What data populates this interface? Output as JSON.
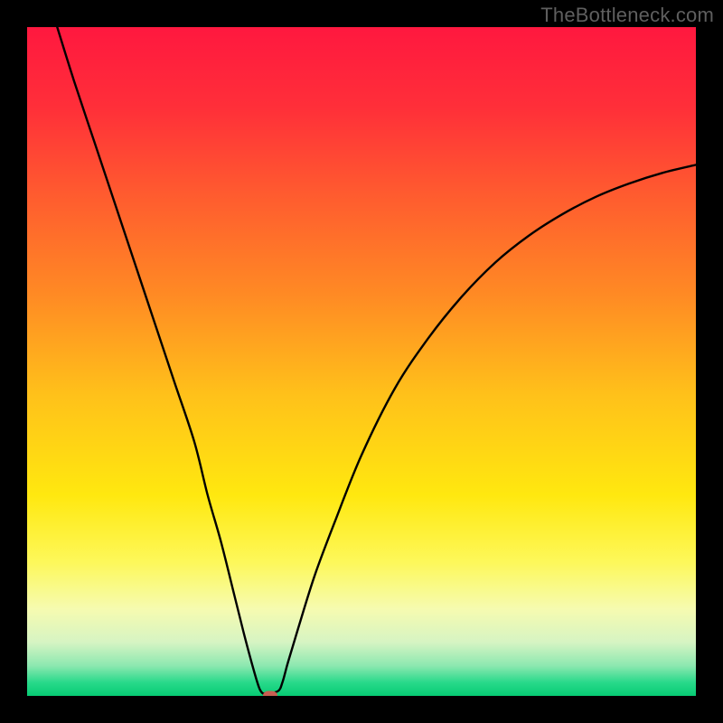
{
  "watermark": "TheBottleneck.com",
  "chart_data": {
    "type": "line",
    "title": "",
    "xlabel": "",
    "ylabel": "",
    "xlim": [
      0,
      100
    ],
    "ylim": [
      0,
      100
    ],
    "grid": false,
    "legend": false,
    "gradient_stops": [
      {
        "pos": 0.0,
        "color": "#ff183f"
      },
      {
        "pos": 0.12,
        "color": "#ff2f39"
      },
      {
        "pos": 0.25,
        "color": "#ff5b2f"
      },
      {
        "pos": 0.4,
        "color": "#ff8a24"
      },
      {
        "pos": 0.55,
        "color": "#ffc11a"
      },
      {
        "pos": 0.7,
        "color": "#ffe80f"
      },
      {
        "pos": 0.8,
        "color": "#fdf85a"
      },
      {
        "pos": 0.87,
        "color": "#f6fbb0"
      },
      {
        "pos": 0.92,
        "color": "#d6f4c3"
      },
      {
        "pos": 0.955,
        "color": "#8ce8b0"
      },
      {
        "pos": 0.98,
        "color": "#28d98a"
      },
      {
        "pos": 1.0,
        "color": "#07cc74"
      }
    ],
    "series": [
      {
        "name": "bottleneck-curve",
        "color": "#000000",
        "x": [
          4.5,
          7,
          10,
          13,
          16,
          19,
          22,
          25,
          27,
          29,
          31,
          32.5,
          33.9,
          34.7,
          35.2,
          35.7,
          37.5,
          38.2,
          39,
          40.5,
          43,
          46,
          50,
          55,
          60,
          65,
          70,
          75,
          80,
          85,
          90,
          95,
          100
        ],
        "y": [
          100,
          92,
          83,
          74,
          65,
          56,
          47,
          38,
          30,
          23,
          15,
          9,
          3.8,
          1.2,
          0.4,
          0.4,
          0.7,
          2.1,
          5,
          10,
          18,
          26,
          36,
          46,
          53.5,
          59.7,
          64.8,
          68.8,
          72,
          74.6,
          76.6,
          78.2,
          79.4
        ]
      }
    ],
    "marker": {
      "x": 36.3,
      "y": 0.0,
      "color": "#c76052"
    }
  }
}
